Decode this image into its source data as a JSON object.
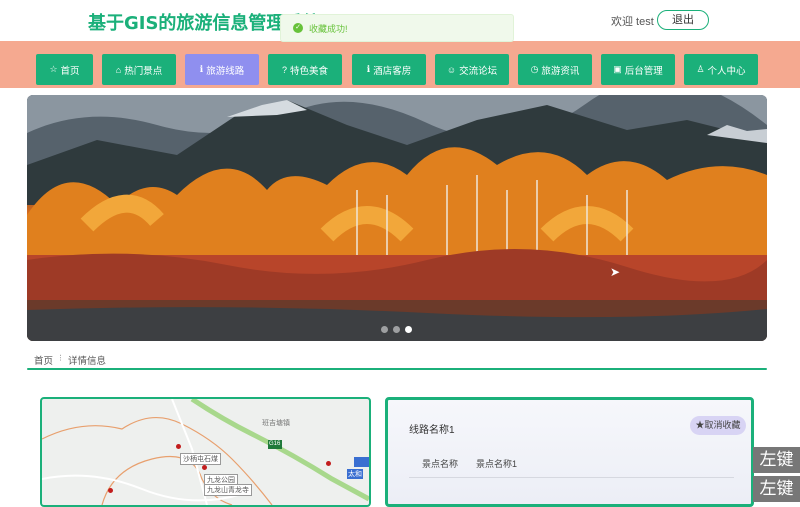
{
  "header": {
    "site_title": "基于GIS的旅游信息管理系统",
    "welcome": "欢迎 test",
    "logout_label": "退出"
  },
  "toast": {
    "text": "收藏成功!"
  },
  "nav": {
    "items": [
      {
        "label": "首页",
        "icon": "star-icon"
      },
      {
        "label": "热门景点",
        "icon": "shopping-bag-icon"
      },
      {
        "label": "旅游线路",
        "icon": "info-icon",
        "active": true
      },
      {
        "label": "特色美食",
        "icon": "question-icon"
      },
      {
        "label": "酒店客房",
        "icon": "info-icon"
      },
      {
        "label": "交流论坛",
        "icon": "chat-icon"
      },
      {
        "label": "旅游资讯",
        "icon": "time-icon"
      },
      {
        "label": "后台管理",
        "icon": "suitcase-icon"
      },
      {
        "label": "个人中心",
        "icon": "user-icon"
      }
    ]
  },
  "carousel": {
    "slide_count": 3,
    "active_index": 2
  },
  "breadcrumb": {
    "home": "首页",
    "current": "详情信息"
  },
  "map": {
    "labels": [
      "沙柄屯石煤",
      "九龙公园",
      "九龙山青龙寺",
      "班吉塘镇",
      "G16",
      "太和"
    ]
  },
  "detail": {
    "route_name": "线路名称1",
    "uncollect_label": "★取消收藏",
    "spot_label": "景点名称",
    "spot_value": "景点名称1"
  },
  "keys": [
    "左键",
    "左键"
  ],
  "colors": {
    "primary": "#1bb07a",
    "nav_bg": "#f5a990",
    "active": "#8f8fef"
  }
}
